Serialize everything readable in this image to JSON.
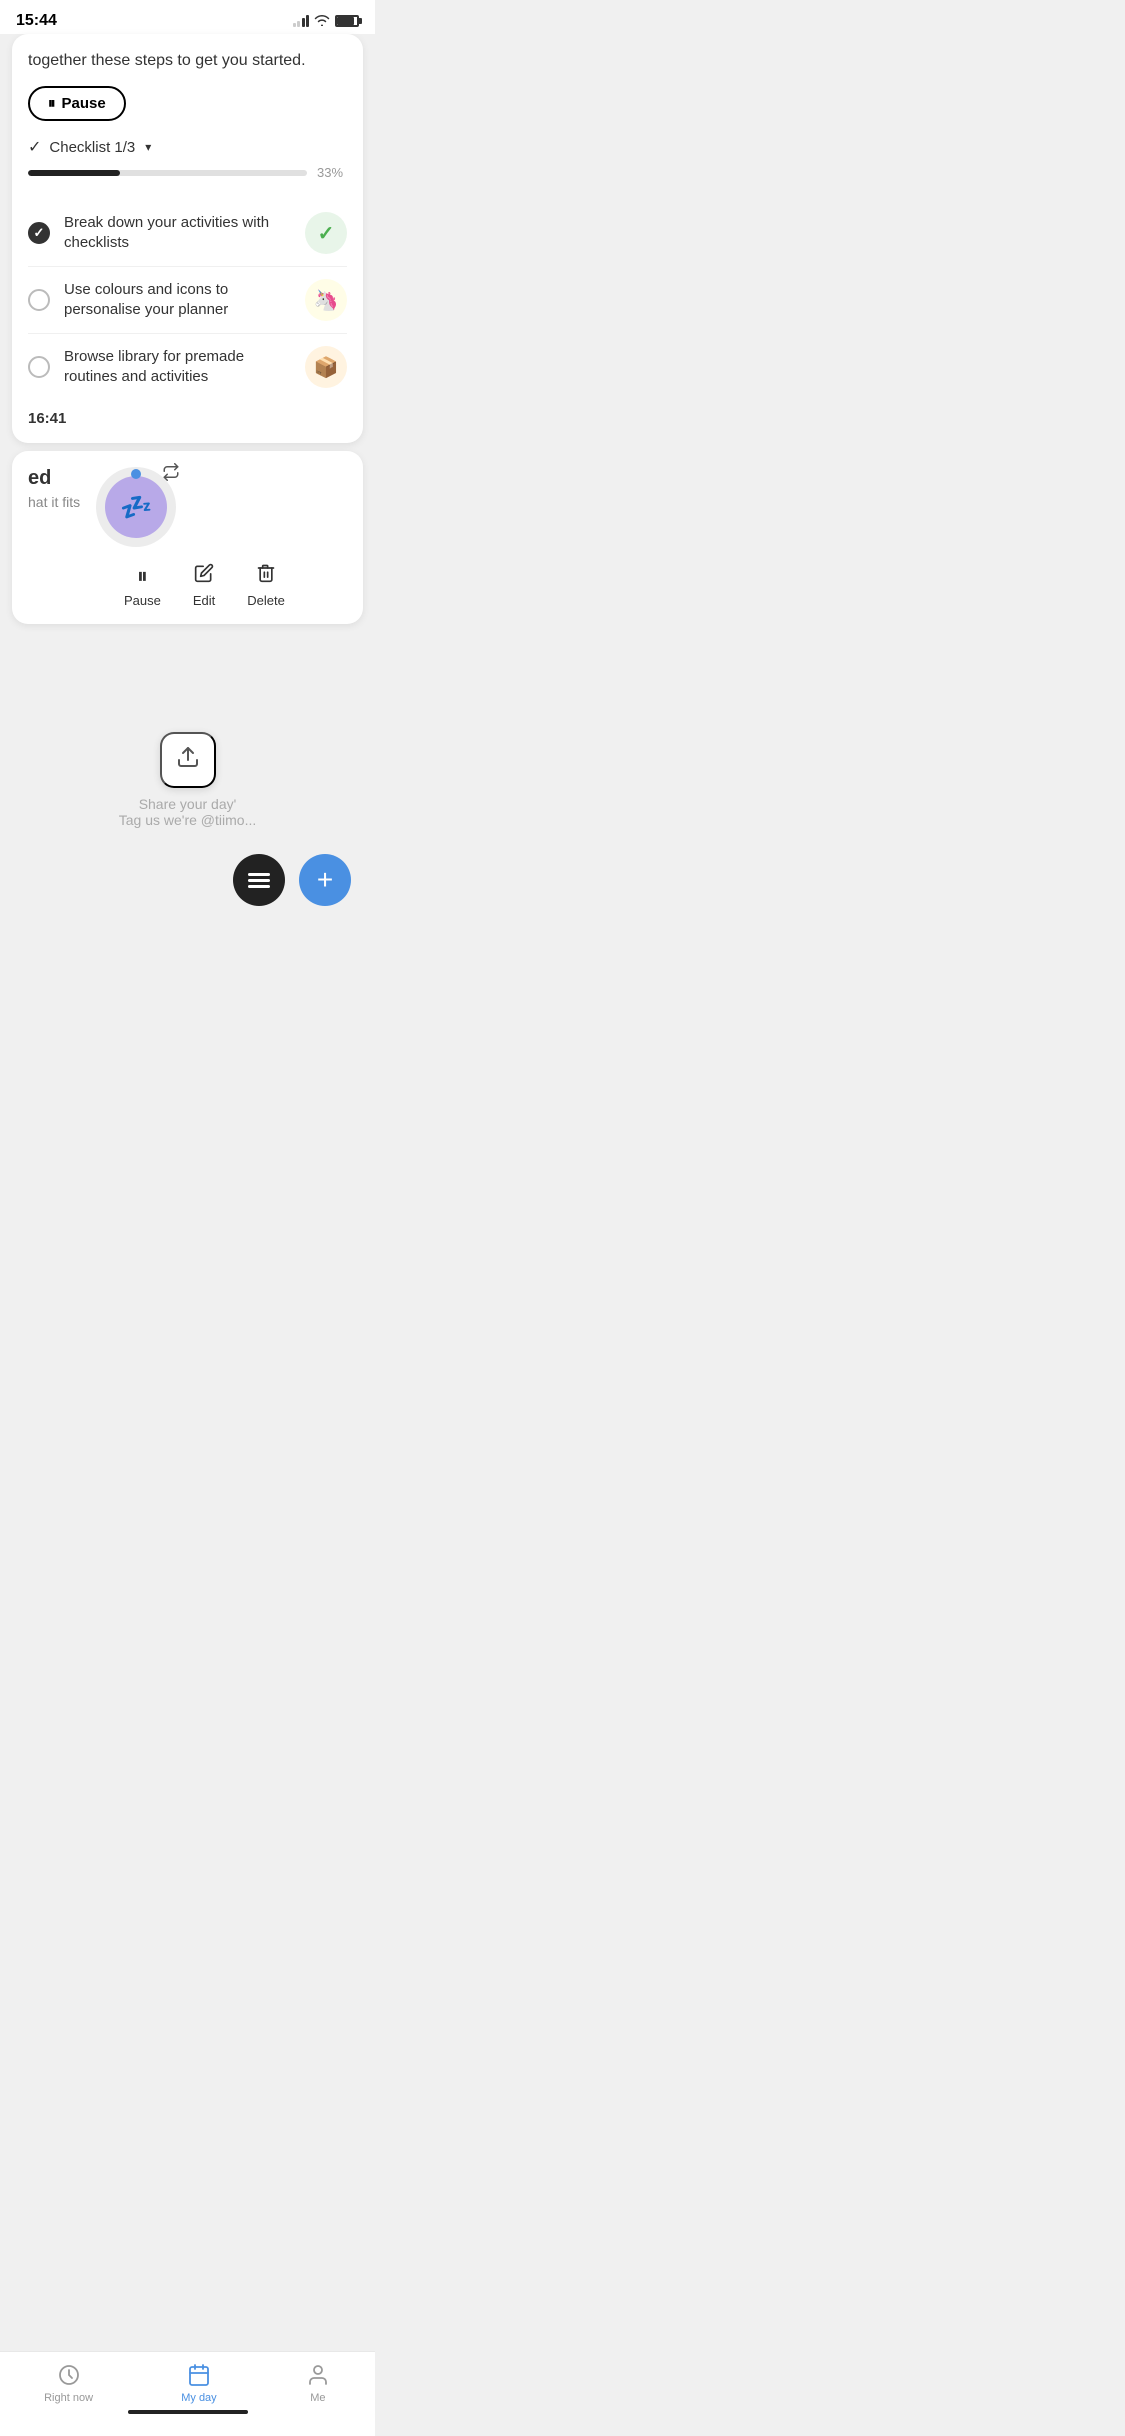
{
  "statusBar": {
    "time": "15:44",
    "signalBars": 2,
    "battery": 85
  },
  "topCard": {
    "introText": "together these steps to get you started.",
    "pauseButton": "Pause",
    "checklist": {
      "label": "Checklist",
      "current": 1,
      "total": 3,
      "progress": 33,
      "progressLabel": "33%",
      "items": [
        {
          "text": "Break down your activities with checklists",
          "checked": true,
          "iconEmoji": "✓",
          "iconBg": "green"
        },
        {
          "text": "Use colours and icons to personalise your planner",
          "checked": false,
          "iconEmoji": "🦄",
          "iconBg": "yellow"
        },
        {
          "text": "Browse library for premade routines and activities",
          "checked": false,
          "iconEmoji": "📦",
          "iconBg": "orange"
        }
      ]
    },
    "timeLabel": "16:41"
  },
  "sleepCard": {
    "titlePartial": "ed",
    "subtitlePartial": "hat it fits",
    "sleepEmoji": "💤",
    "actions": {
      "pause": "Pause",
      "edit": "Edit",
      "delete": "Delete"
    }
  },
  "shareSection": {
    "uploadIcon": "↑",
    "shareText": "Share your day'",
    "tagText": "Tag us we're @tiimo..."
  },
  "bottomNav": {
    "items": [
      {
        "label": "Right now",
        "active": false,
        "icon": "clock"
      },
      {
        "label": "My day",
        "active": true,
        "icon": "calendar"
      },
      {
        "label": "Me",
        "active": false,
        "icon": "person"
      }
    ]
  }
}
